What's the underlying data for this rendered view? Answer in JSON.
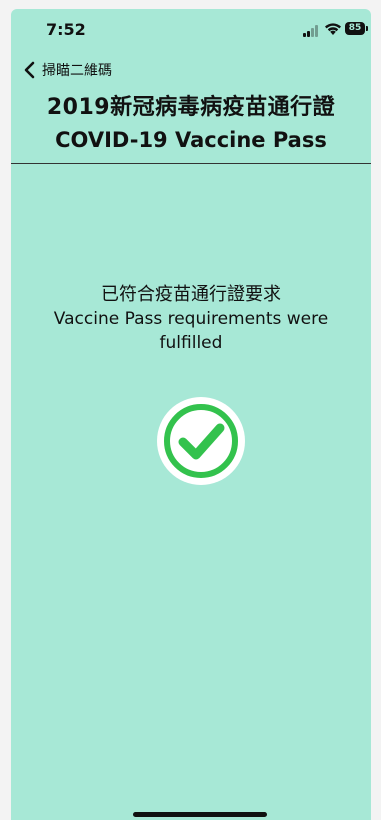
{
  "status_bar": {
    "time": "7:52",
    "battery": "85"
  },
  "nav": {
    "back_label": "掃瞄二維碼"
  },
  "header": {
    "title_zh": "2019新冠病毒病疫苗通行證",
    "title_en": "COVID-19 Vaccine Pass"
  },
  "result": {
    "message_zh": "已符合疫苗通行證要求",
    "message_en": "Vaccine Pass requirements were fulfilled"
  },
  "colors": {
    "background": "#a7e8d6",
    "check_green": "#33c24d"
  }
}
